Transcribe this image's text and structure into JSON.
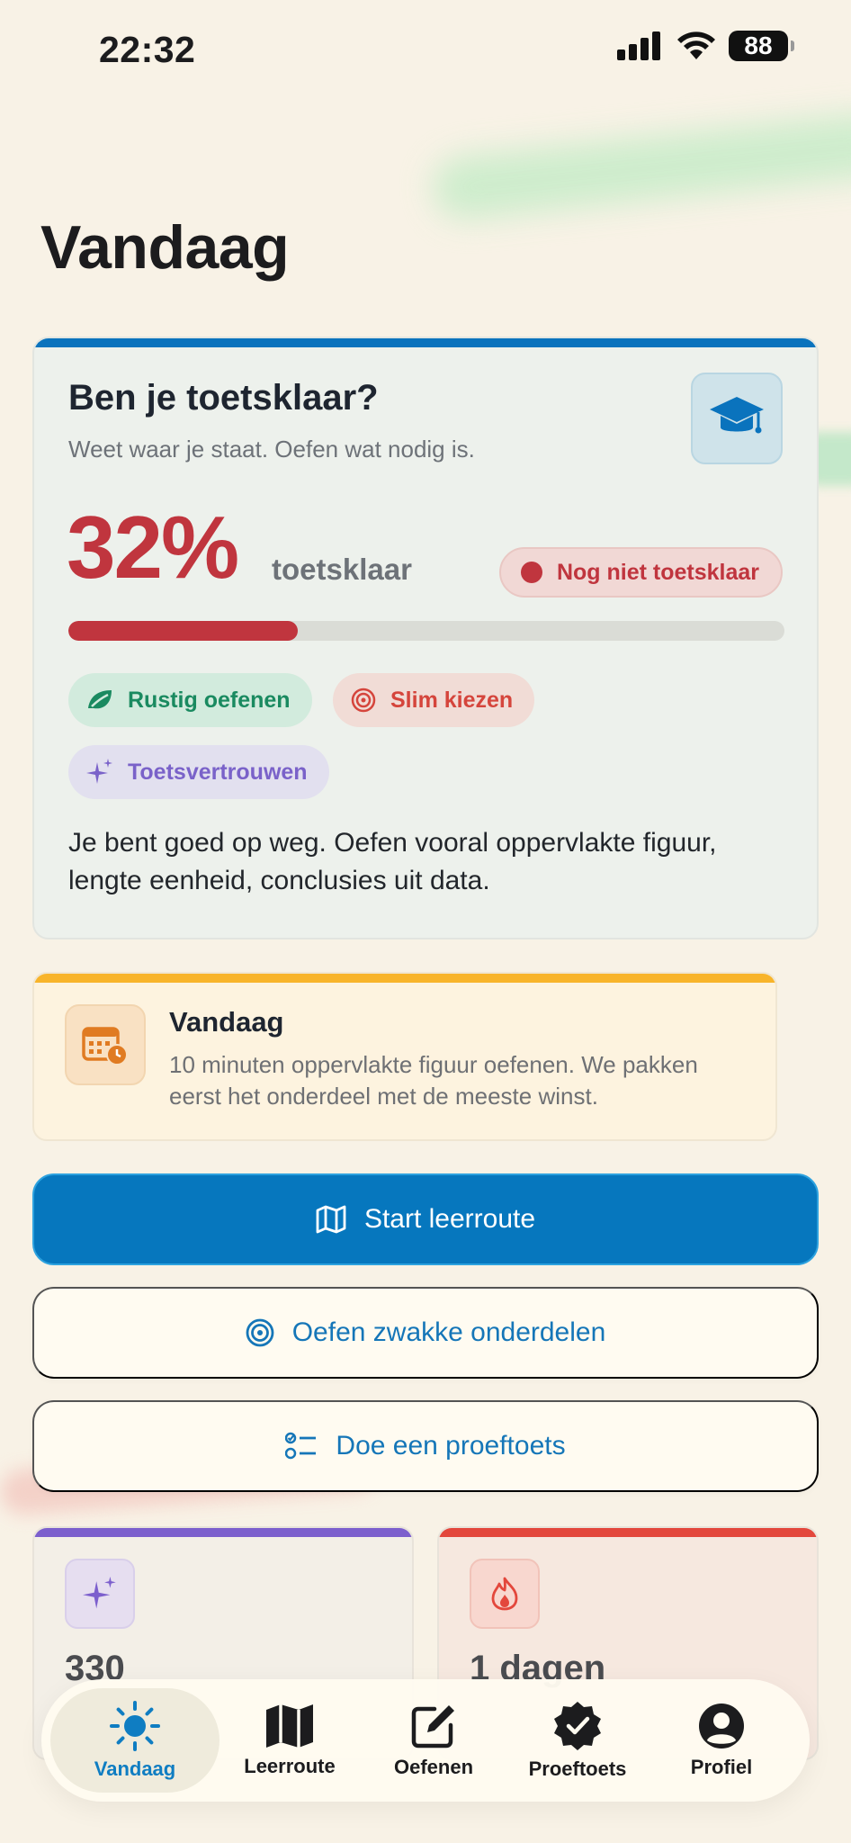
{
  "status_bar": {
    "time": "22:32",
    "battery": "88"
  },
  "page_title": "Vandaag",
  "readiness": {
    "title": "Ben je toetsklaar?",
    "subtitle": "Weet waar je staat. Oefen wat nodig is.",
    "percent_text": "32%",
    "percent_value": 32,
    "percent_label": "toetsklaar",
    "badge": "Nog niet toetsklaar",
    "chips": [
      "Rustig oefenen",
      "Slim kiezen",
      "Toetsvertrouwen"
    ],
    "advice": "Je bent goed op weg. Oefen vooral oppervlakte figuur, lengte eenheid, conclusies uit data.",
    "colors": {
      "accent": "#0a73bd",
      "danger": "#c0353e"
    }
  },
  "today": {
    "title": "Vandaag",
    "text": "10 minuten oppervlakte figuur oefenen. We pakken eerst het onderdeel met de meeste winst."
  },
  "actions": {
    "start_route": "Start leerroute",
    "practice_weak": "Oefen zwakke onderdelen",
    "practice_test": "Doe een proeftoets"
  },
  "stats": {
    "xp_value": "330",
    "streak_value": "1 dagen"
  },
  "nav": {
    "items": [
      "Vandaag",
      "Leerroute",
      "Oefenen",
      "Proeftoets",
      "Profiel"
    ],
    "active": "Vandaag"
  }
}
